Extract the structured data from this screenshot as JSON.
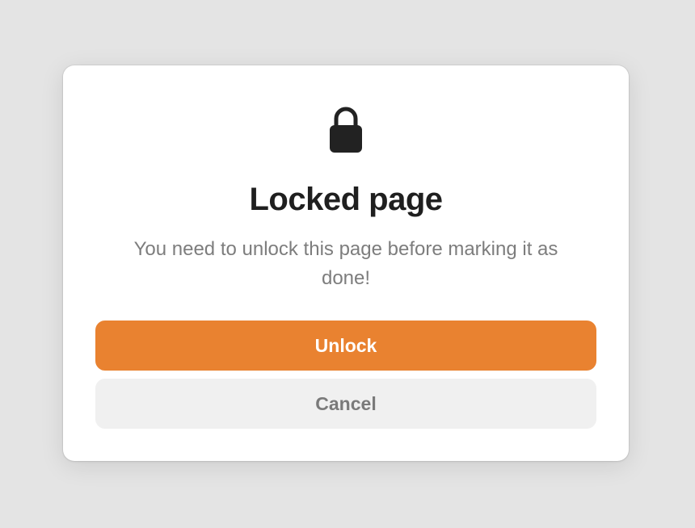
{
  "dialog": {
    "icon": "lock-icon",
    "title": "Locked page",
    "message": "You need to unlock this page before marking it as done!",
    "primary_button": {
      "label": "Unlock",
      "color": "#E98230"
    },
    "secondary_button": {
      "label": "Cancel",
      "color": "#F0F0F0"
    }
  }
}
